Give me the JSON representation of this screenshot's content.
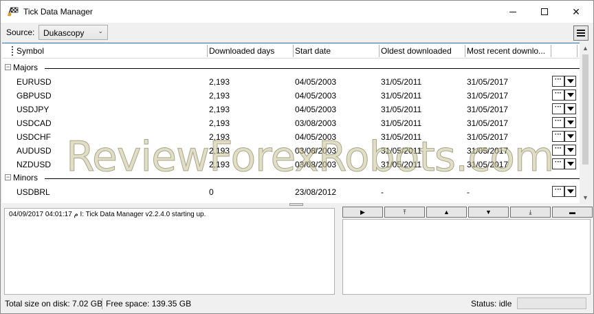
{
  "window": {
    "title": "Tick Data Manager",
    "icons": {
      "app": "racing-flag-icon",
      "minimize": "minimize-icon",
      "maximize": "maximize-icon",
      "close": "close-icon"
    },
    "close_glyph": "✕"
  },
  "toolbar": {
    "source_label": "Source:",
    "source_value": "Dukascopy",
    "source_arrow": "⌄",
    "menu_icon": "hamburger-menu-icon"
  },
  "grid": {
    "columns": [
      "Symbol",
      "Downloaded days",
      "Start date",
      "Oldest downloaded",
      "Most recent downlo..."
    ],
    "groups": [
      {
        "label": "Majors",
        "toggle": "−",
        "rows": [
          {
            "symbol": "EURUSD",
            "days": "2,193",
            "start": "04/05/2003",
            "oldest": "31/05/2011",
            "recent": "31/05/2017"
          },
          {
            "symbol": "GBPUSD",
            "days": "2,193",
            "start": "04/05/2003",
            "oldest": "31/05/2011",
            "recent": "31/05/2017"
          },
          {
            "symbol": "USDJPY",
            "days": "2,193",
            "start": "04/05/2003",
            "oldest": "31/05/2011",
            "recent": "31/05/2017"
          },
          {
            "symbol": "USDCAD",
            "days": "2,193",
            "start": "03/08/2003",
            "oldest": "31/05/2011",
            "recent": "31/05/2017"
          },
          {
            "symbol": "USDCHF",
            "days": "2,193",
            "start": "04/05/2003",
            "oldest": "31/05/2011",
            "recent": "31/05/2017"
          },
          {
            "symbol": "AUDUSD",
            "days": "2,193",
            "start": "03/08/2003",
            "oldest": "31/05/2011",
            "recent": "31/05/2017"
          },
          {
            "symbol": "NZDUSD",
            "days": "2,193",
            "start": "03/08/2003",
            "oldest": "31/05/2011",
            "recent": "31/05/2017"
          }
        ]
      },
      {
        "label": "Minors",
        "toggle": "−",
        "rows": [
          {
            "symbol": "USDBRL",
            "days": "0",
            "start": "23/08/2012",
            "oldest": "-",
            "recent": "-"
          }
        ]
      }
    ],
    "row_button_dots": "···",
    "row_button_icons": {
      "dots": "more-icon",
      "drop": "dropdown-arrow-icon"
    },
    "scroll_up": "▲",
    "scroll_down": "▼"
  },
  "log": {
    "line": "04/09/2017 04:01:17 م  I: Tick Data Manager v2.2.4.0 starting up."
  },
  "controls": {
    "buttons": [
      {
        "name": "play-button",
        "glyph": "▶",
        "icon": "play-icon"
      },
      {
        "name": "move-top-button",
        "glyph": "⤒",
        "icon": "move-top-icon"
      },
      {
        "name": "move-up-button",
        "glyph": "▲",
        "icon": "move-up-icon"
      },
      {
        "name": "move-down-button",
        "glyph": "▼",
        "icon": "move-down-icon"
      },
      {
        "name": "move-bottom-button",
        "glyph": "⤓",
        "icon": "move-bottom-icon"
      },
      {
        "name": "remove-button",
        "glyph": "▬",
        "icon": "remove-icon"
      }
    ]
  },
  "status": {
    "total_size": "Total size on disk: 7.02 GB",
    "free_space": "Free space: 139.35 GB",
    "status": "Status: idle",
    "progress": 0
  },
  "watermark": {
    "text": "ReviewForexRobots.com"
  }
}
